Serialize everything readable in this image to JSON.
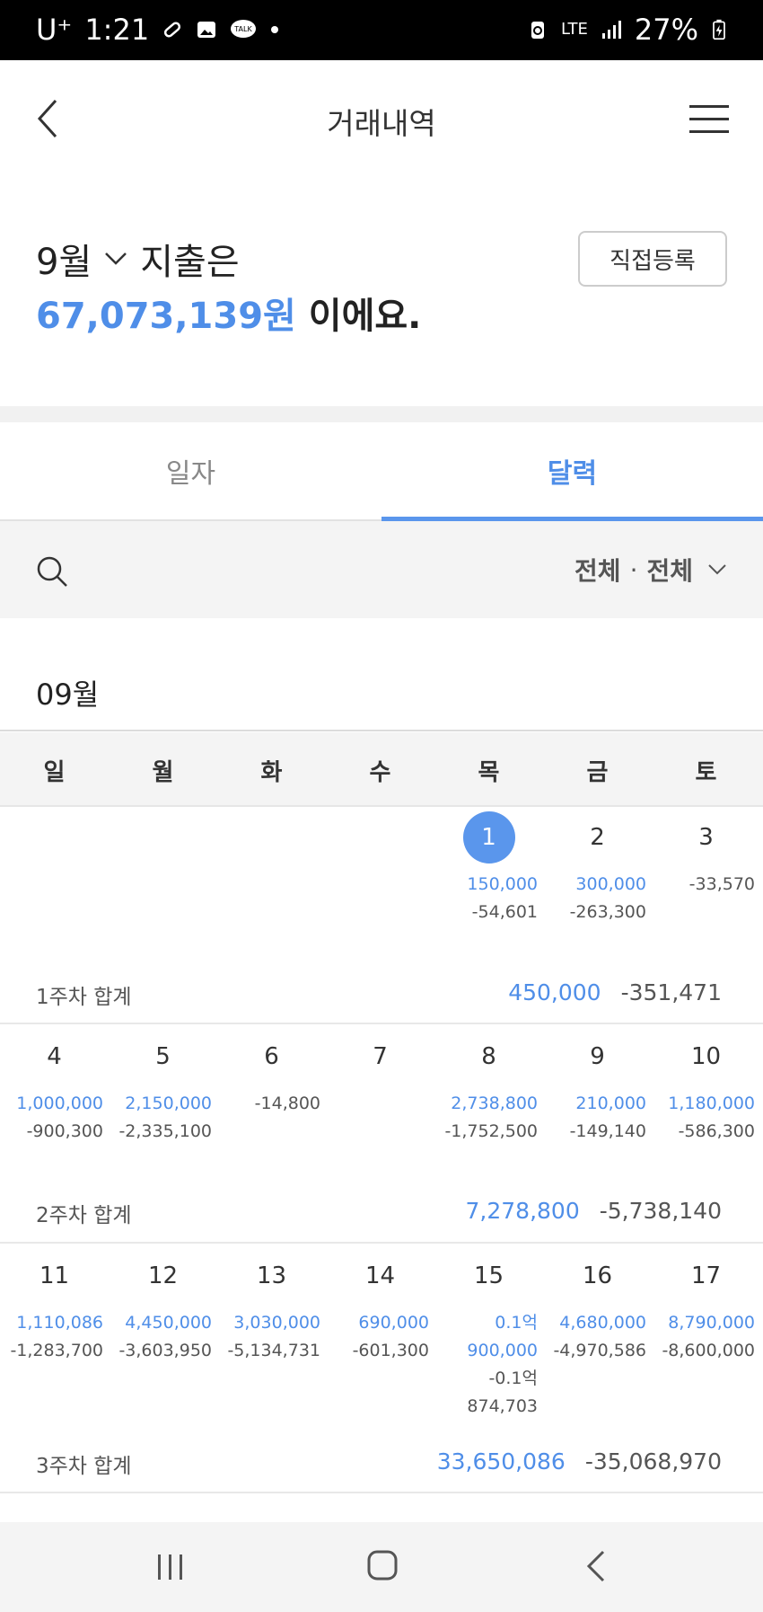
{
  "status_bar": {
    "carrier": "U⁺",
    "time": "1:21",
    "network": "LTE",
    "battery": "27%"
  },
  "header": {
    "title": "거래내역"
  },
  "summary": {
    "month": "9월",
    "line1_suffix": "지출은",
    "amount": "67,073,139원",
    "line2_suffix": " 이에요.",
    "register_button": "직접등록"
  },
  "tabs": [
    {
      "label": "일자",
      "active": false
    },
    {
      "label": "달력",
      "active": true
    }
  ],
  "filter": {
    "first": "전체",
    "separator": "·",
    "second": "전체"
  },
  "calendar": {
    "month_title": "09월",
    "weekdays": [
      "일",
      "월",
      "화",
      "수",
      "목",
      "금",
      "토"
    ],
    "weeks": [
      {
        "days": [
          null,
          null,
          null,
          null,
          {
            "day": "1",
            "today": true,
            "income": [
              "150,000"
            ],
            "expense": [
              "-54,601"
            ]
          },
          {
            "day": "2",
            "income": [
              "300,000"
            ],
            "expense": [
              "-263,300"
            ]
          },
          {
            "day": "3",
            "income": [],
            "expense": [
              "-33,570"
            ]
          }
        ],
        "summary_label": "1주차 합계",
        "summary_income": "450,000",
        "summary_expense": "-351,471"
      },
      {
        "days": [
          {
            "day": "4",
            "income": [
              "1,000,000"
            ],
            "expense": [
              "-900,300"
            ]
          },
          {
            "day": "5",
            "income": [
              "2,150,000"
            ],
            "expense": [
              "-2,335,100"
            ]
          },
          {
            "day": "6",
            "income": [],
            "expense": [
              "-14,800"
            ]
          },
          {
            "day": "7",
            "income": [],
            "expense": []
          },
          {
            "day": "8",
            "income": [
              "2,738,800"
            ],
            "expense": [
              "-1,752,500"
            ]
          },
          {
            "day": "9",
            "income": [
              "210,000"
            ],
            "expense": [
              "-149,140"
            ]
          },
          {
            "day": "10",
            "income": [
              "1,180,000"
            ],
            "expense": [
              "-586,300"
            ]
          }
        ],
        "summary_label": "2주차 합계",
        "summary_income": "7,278,800",
        "summary_expense": "-5,738,140"
      },
      {
        "days": [
          {
            "day": "11",
            "income": [
              "1,110,086"
            ],
            "expense": [
              "-1,283,700"
            ]
          },
          {
            "day": "12",
            "income": [
              "4,450,000"
            ],
            "expense": [
              "-3,603,950"
            ]
          },
          {
            "day": "13",
            "income": [
              "3,030,000"
            ],
            "expense": [
              "-5,134,731"
            ]
          },
          {
            "day": "14",
            "income": [
              "690,000"
            ],
            "expense": [
              "-601,300"
            ]
          },
          {
            "day": "15",
            "income": [
              "0.1억",
              "900,000"
            ],
            "expense": [
              "-0.1억",
              "874,703"
            ]
          },
          {
            "day": "16",
            "income": [
              "4,680,000"
            ],
            "expense": [
              "-4,970,586"
            ]
          },
          {
            "day": "17",
            "income": [
              "8,790,000"
            ],
            "expense": [
              "-8,600,000"
            ]
          }
        ],
        "summary_label": "3주차 합계",
        "summary_income": "33,650,086",
        "summary_expense": "-35,068,970"
      }
    ]
  },
  "colors": {
    "accent": "#4f8ee8",
    "today_circle": "#5a96ec",
    "band": "#f4f4f4"
  },
  "icons": [
    "back-arrow-icon",
    "hamburger-menu-icon",
    "chevron-down-icon",
    "search-icon",
    "recent-apps-icon",
    "home-icon",
    "nav-back-icon"
  ]
}
